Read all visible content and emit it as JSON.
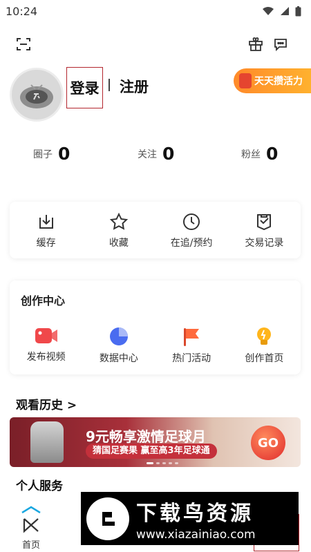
{
  "status_bar": {
    "time": "10:24"
  },
  "user": {
    "login_label": "登录",
    "register_label": "注册"
  },
  "promo": {
    "label": "天天攒活力"
  },
  "stats": [
    {
      "label": "圈子",
      "value": "0"
    },
    {
      "label": "关注",
      "value": "0"
    },
    {
      "label": "粉丝",
      "value": "0"
    }
  ],
  "quick_actions": [
    {
      "label": "缓存",
      "icon": "download-icon"
    },
    {
      "label": "收藏",
      "icon": "star-icon"
    },
    {
      "label": "在追/预约",
      "icon": "clock-icon"
    },
    {
      "label": "交易记录",
      "icon": "receipt-icon"
    }
  ],
  "creation_center": {
    "title": "创作中心",
    "items": [
      {
        "label": "发布视频",
        "icon": "video-icon",
        "color": "#f0484a"
      },
      {
        "label": "数据中心",
        "icon": "pie-chart-icon",
        "color": "#4a6cf0"
      },
      {
        "label": "热门活动",
        "icon": "flag-icon",
        "color": "#ff6a3d"
      },
      {
        "label": "创作首页",
        "icon": "bulb-icon",
        "color": "#ffb51b"
      }
    ]
  },
  "history": {
    "title": "观看历史 >"
  },
  "banner": {
    "title": "9元畅享激情足球月",
    "subtitle": "猜国足赛果 赢至高3年足球通",
    "cta": "GO"
  },
  "personal_services": {
    "title": "个人服务"
  },
  "tabbar": [
    {
      "label": "首页"
    },
    {
      "label": ""
    },
    {
      "label": ""
    },
    {
      "label": ""
    },
    {
      "label": ""
    }
  ],
  "watermark": {
    "title": "下载鸟资源",
    "url": "www.xiazainiao.com"
  },
  "colors": {
    "accent": "#b3262e",
    "promo": "#ff8a2a"
  }
}
